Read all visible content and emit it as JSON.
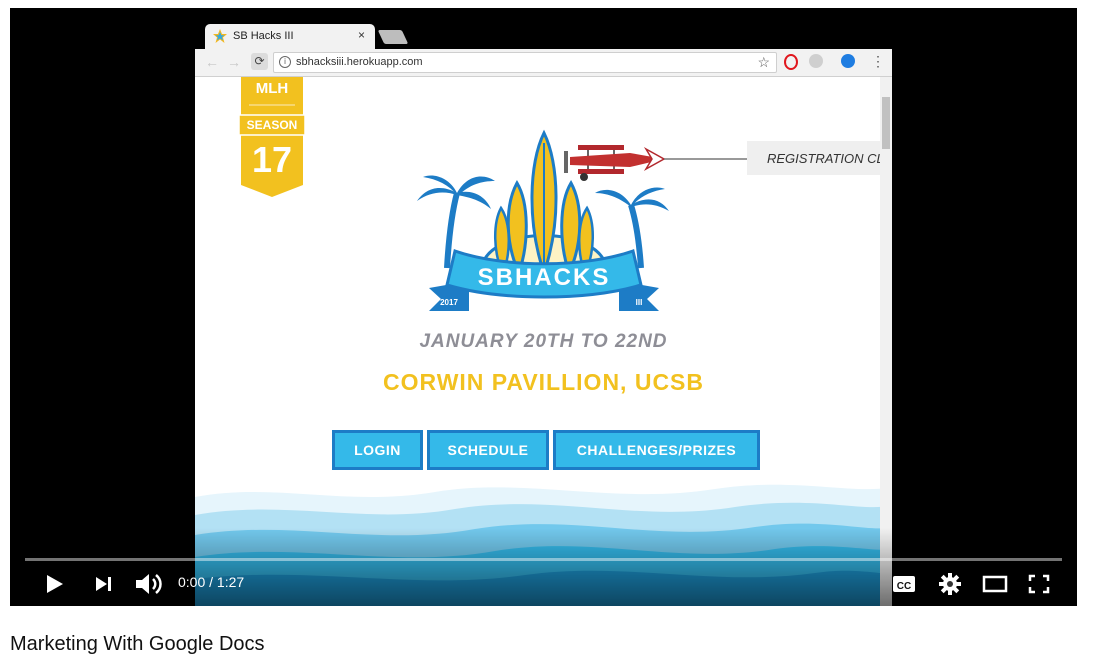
{
  "video": {
    "time": "0:00 / 1:27",
    "progress": 0,
    "title": "Marketing With Google Docs"
  },
  "browser": {
    "tab_title": "SB Hacks III",
    "tab_close": "×",
    "url": "sbhacksiii.herokuapp.com"
  },
  "site": {
    "mlh_top": "MLH",
    "mlh_season": "SEASON",
    "mlh_number": "17",
    "banner": "REGISTRATION CL",
    "logo_text": "SBHACKS",
    "logo_year": "2017",
    "logo_numeral": "III",
    "date": "JANUARY 20TH TO 22ND",
    "venue": "CORWIN PAVILLION, UCSB",
    "buttons": [
      {
        "label": "LOGIN"
      },
      {
        "label": "SCHEDULE"
      },
      {
        "label": "CHALLENGES/PRIZES"
      }
    ]
  },
  "colors": {
    "accent_yellow": "#f2c11f",
    "accent_blue": "#34b9e9",
    "button_border": "#1d7cc6",
    "date_gray": "#8e8e96"
  },
  "icons": [
    "play-icon",
    "next-icon",
    "volume-icon",
    "cc-icon",
    "settings-icon",
    "theater-icon",
    "fullscreen-icon"
  ]
}
